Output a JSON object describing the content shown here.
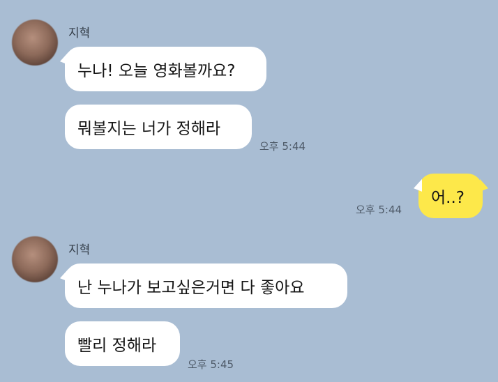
{
  "chat": {
    "groups": [
      {
        "sender": "지혁",
        "messages": [
          "누나! 오늘 영화볼까요?",
          "뭐볼지는 너가 정해라"
        ],
        "time": "오후 5:44"
      },
      {
        "sender": "지혁",
        "messages": [
          "난 누나가 보고싶은거면 다 좋아요",
          "빨리 정해라"
        ],
        "time": "오후 5:45"
      }
    ],
    "my_message": {
      "text": "어..?",
      "time": "오후 5:44"
    }
  },
  "colors": {
    "background": "#a9bdd3",
    "incoming_bubble": "#ffffff",
    "outgoing_bubble": "#fde84a"
  }
}
